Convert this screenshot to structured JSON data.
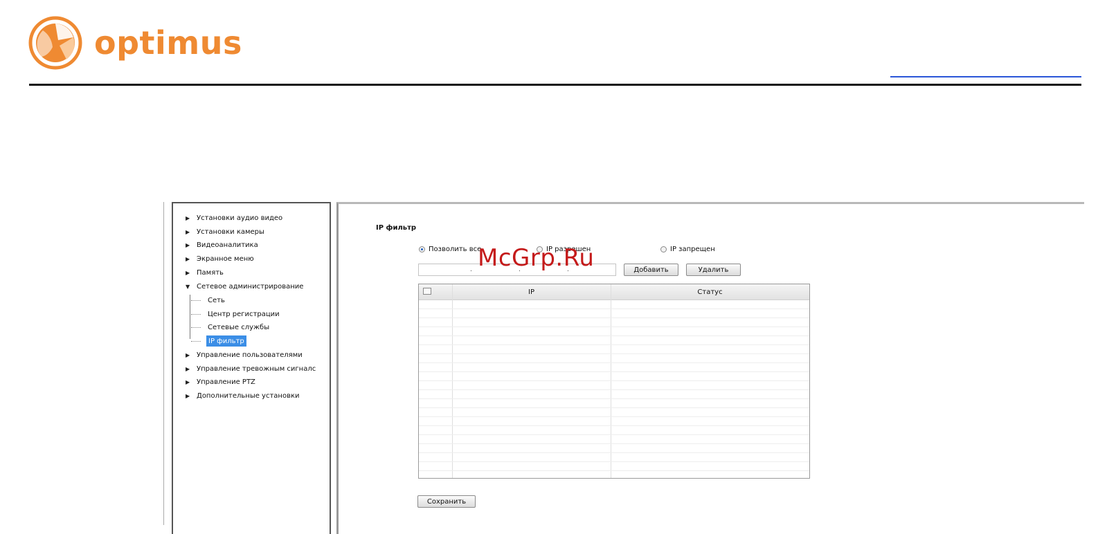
{
  "brand": {
    "name": "optimus",
    "color": "#ef8a32"
  },
  "watermark": "McGrp.Ru",
  "sidebar": {
    "items": [
      {
        "label": "Установки аудио видео",
        "expanded": false
      },
      {
        "label": "Установки камеры",
        "expanded": false
      },
      {
        "label": "Видеоаналитика",
        "expanded": false
      },
      {
        "label": "Экранное меню",
        "expanded": false
      },
      {
        "label": "Память",
        "expanded": false
      },
      {
        "label": "Сетевое администрирование",
        "expanded": true
      },
      {
        "label": "Управление пользователями",
        "expanded": false
      },
      {
        "label": "Управление тревожным сигналс",
        "expanded": false
      },
      {
        "label": "Управление PTZ",
        "expanded": false
      },
      {
        "label": "Дополнительные установки",
        "expanded": false
      }
    ],
    "subitems": [
      {
        "label": "Сеть",
        "selected": false
      },
      {
        "label": "Центр регистрации",
        "selected": false
      },
      {
        "label": "Сетевые службы",
        "selected": false
      },
      {
        "label": "IP фильтр",
        "selected": true
      }
    ],
    "selected_color": "#3b8ee6"
  },
  "main": {
    "title": "IP фильтр",
    "radios": [
      {
        "label": "Позволить все",
        "checked": true
      },
      {
        "label": "IP разрешен",
        "checked": false
      },
      {
        "label": "IP запрещен",
        "checked": false
      }
    ],
    "ip_dots": [
      ".",
      ".",
      "."
    ],
    "add_label": "Добавить",
    "delete_label": "Удалить",
    "table": {
      "columns": [
        "IP",
        "Статус"
      ],
      "rows": []
    },
    "save_label": "Сохранить"
  }
}
